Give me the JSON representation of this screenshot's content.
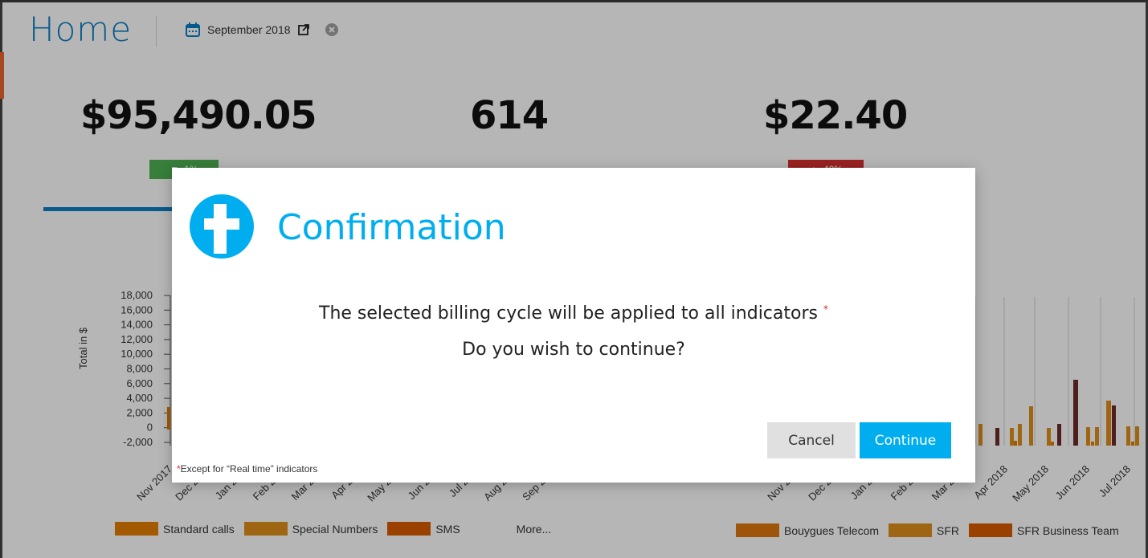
{
  "header": {
    "title": "Home",
    "period_label": "September 2018",
    "calendar_icon": "calendar-icon",
    "external_icon": "external-link-icon",
    "clear_icon": "clear-icon"
  },
  "kpis": [
    {
      "value": "$95,490.05",
      "badge": "1%",
      "badge_color": "#4caf50"
    },
    {
      "value": "614"
    },
    {
      "value": "$22.40",
      "badge": "40%",
      "badge_color": "#d32f2f"
    }
  ],
  "left_chart": {
    "ylabel": "Total in $",
    "yticks": [
      "18,000",
      "16,000",
      "14,000",
      "12,000",
      "10,000",
      "8,000",
      "6,000",
      "4,000",
      "2,000",
      "0",
      "-2,000"
    ],
    "xticks": [
      "Nov 2017",
      "Dec 2017",
      "Jan 2018",
      "Feb 2018",
      "Mar 2018",
      "Apr 2018",
      "May 2018",
      "Jun 2018",
      "Jul 2018",
      "Aug 2018",
      "Sep 2018"
    ],
    "legend": [
      "Standard calls",
      "Special Numbers",
      "SMS",
      "More..."
    ]
  },
  "right_chart": {
    "xticks": [
      "Nov 2017",
      "Dec 2017",
      "Jan 2018",
      "Feb 2018",
      "Mar 2018",
      "Apr 2018",
      "May 2018",
      "Jun 2018",
      "Jul 2018"
    ],
    "legend": [
      "Bouygues Telecom",
      "SFR",
      "SFR Business Team"
    ]
  },
  "modal": {
    "title": "Confirmation",
    "message_line1": "The selected billing cycle will be applied to all indicators",
    "message_line2": "Do you wish to continue?",
    "cancel_label": "Cancel",
    "continue_label": "Continue",
    "footnote": "Except for “Real time” indicators",
    "asterisk": "*"
  },
  "colors": {
    "accent": "#00aeef",
    "primary": "#0a7cc1",
    "orange1": "#e07b00",
    "orange2": "#d98c1a",
    "orange3": "#d45a00",
    "darkred": "#6b2a2a"
  }
}
